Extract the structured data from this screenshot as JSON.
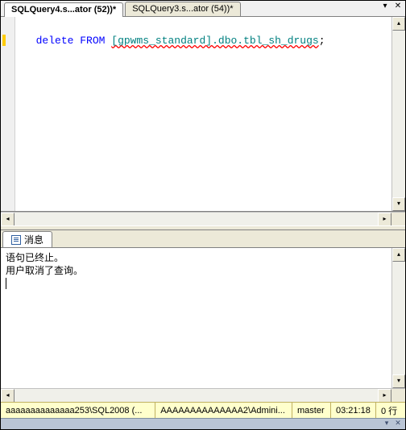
{
  "tabs": {
    "items": [
      {
        "label": "SQLQuery4.s...ator (52))*"
      },
      {
        "label": "SQLQuery3.s...ator (54))*"
      }
    ],
    "dropdown_glyph": "▾",
    "close_glyph": "✕"
  },
  "sql": {
    "line1_indent": "  ",
    "kw_delete": "delete",
    "sp1": " ",
    "kw_from": "FROM",
    "sp2": " ",
    "obj": "[gpwms_standard].dbo.tbl_sh_drugs",
    "semi": ";"
  },
  "scroll": {
    "up": "▴",
    "down": "▾",
    "left": "◂",
    "right": "▸"
  },
  "messages": {
    "tab_label": "消息",
    "line1": "语句已终止。",
    "line2": "用户取消了查询。"
  },
  "status": {
    "server": "aaaaaaaaaaaaaa253\\SQL2008 (...",
    "user": "AAAAAAAAAAAAAA2\\Admini...",
    "db": "master",
    "time": "03:21:18",
    "rows": "0 行"
  },
  "footer": {
    "dropdown": "▾",
    "close": "✕"
  }
}
